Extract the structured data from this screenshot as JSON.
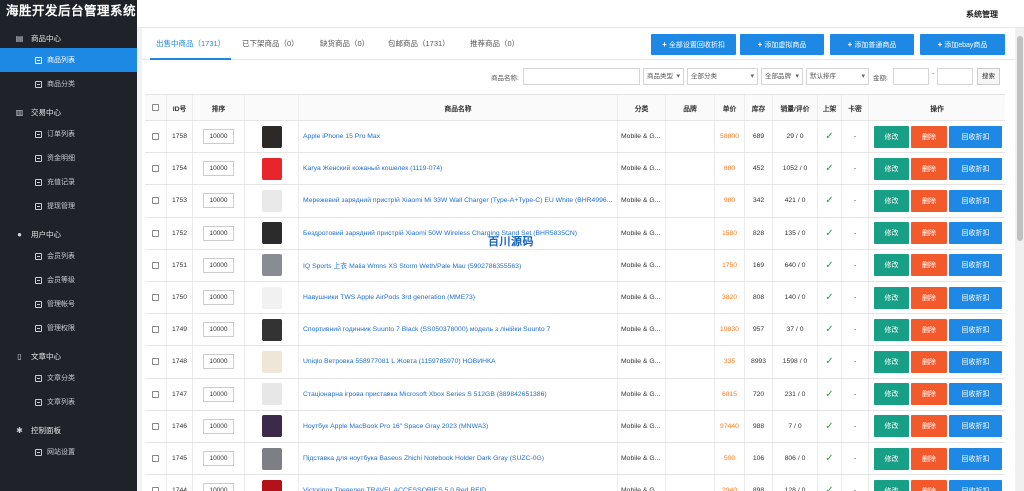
{
  "app": {
    "title": "海胜开发后台管理系统",
    "header_right": "系统管理"
  },
  "sidebar": {
    "groups": [
      {
        "label": "商品中心",
        "icon": "clipboard-icon",
        "items": [
          {
            "label": "商品列表",
            "active": true
          },
          {
            "label": "商品分类",
            "active": false
          }
        ]
      },
      {
        "label": "交易中心",
        "icon": "chart-bar-icon",
        "items": [
          {
            "label": "订单列表"
          },
          {
            "label": "资金明细"
          },
          {
            "label": "充值记录"
          },
          {
            "label": "提现管理"
          }
        ]
      },
      {
        "label": "用户中心",
        "icon": "user-icon",
        "items": [
          {
            "label": "会员列表"
          },
          {
            "label": "会员等级"
          },
          {
            "label": "管理帐号"
          },
          {
            "label": "管理权限"
          }
        ]
      },
      {
        "label": "文章中心",
        "icon": "document-icon",
        "items": [
          {
            "label": "文章分类"
          },
          {
            "label": "文章列表"
          }
        ]
      },
      {
        "label": "控制面板",
        "icon": "gear-icon",
        "items": [
          {
            "label": "网站设置"
          }
        ]
      }
    ]
  },
  "tabs": [
    {
      "label": "出售中商品（1731）",
      "active": true
    },
    {
      "label": "已下架商品（0）",
      "active": false
    },
    {
      "label": "缺货商品（0）",
      "active": false
    },
    {
      "label": "包邮商品（1731）",
      "active": false
    },
    {
      "label": "推荐商品（0）",
      "active": false
    }
  ],
  "toolbar": {
    "btn_discount": "全部设置回收折扣",
    "btn_virtual": "添加虚拟商品",
    "btn_normal": "添加普通商品",
    "btn_ebay": "添加ebay商品"
  },
  "search": {
    "name_label": "商品名称:",
    "type_select": "商品类型",
    "category_select": "全部分类",
    "brand_select": "全部品牌",
    "sort_select": "默认排序",
    "amount_label": "金额:",
    "dash": "-",
    "search_btn": "搜索"
  },
  "table": {
    "headers": {
      "id": "ID号",
      "sort": "排序",
      "name": "商品名称",
      "category": "分类",
      "brand": "品牌",
      "price": "单价",
      "stock": "库存",
      "sales": "销量/评价",
      "onshelf": "上架",
      "card": "卡密",
      "actions": "操作"
    },
    "actions": {
      "edit": "修改",
      "delete": "删除",
      "recycle": "回收折扣"
    },
    "rows": [
      {
        "id": "1758",
        "sort": "10000",
        "name": "Apple iPhone 15 Pro Max",
        "category": "Mobile & G...",
        "price": "58800",
        "stock": "689",
        "sales": "29 / 0",
        "card": "-",
        "img": "#2c2a29"
      },
      {
        "id": "1754",
        "sort": "10000",
        "name": "Karya Женский кожаный кошелек (1119-074)",
        "category": "Mobile & G...",
        "price": "680",
        "stock": "452",
        "sales": "1052 / 0",
        "card": "-",
        "img": "#e8252b"
      },
      {
        "id": "1753",
        "sort": "10000",
        "name": "Мережевий зарядний пристрій Xiaomi Mi 33W Wall Charger (Type-A+Type-C) EU White (BHR4996...",
        "category": "Mobile & G...",
        "price": "980",
        "stock": "342",
        "sales": "421 / 0",
        "card": "-",
        "img": "#e9e9e9"
      },
      {
        "id": "1752",
        "sort": "10000",
        "name": "Бездротовий зарядний пристрій Xiaomi 50W Wireless Charging Stand Set (BHR5835CN)",
        "category": "Mobile & G...",
        "price": "1580",
        "stock": "828",
        "sales": "135 / 0",
        "card": "-",
        "img": "#2b2b2b"
      },
      {
        "id": "1751",
        "sort": "10000",
        "name": "IQ Sports 上衣 Malia Wmns XS Storm Weth/Pale Mau (5902786355563)",
        "category": "Mobile & G...",
        "price": "1750",
        "stock": "169",
        "sales": "640 / 0",
        "card": "-",
        "img": "#8a8c94"
      },
      {
        "id": "1750",
        "sort": "10000",
        "name": "Навушники TWS Apple AirPods 3rd generation (MME73)",
        "category": "Mobile & G...",
        "price": "3820",
        "stock": "808",
        "sales": "140 / 0",
        "card": "-",
        "img": "#f1f1f1"
      },
      {
        "id": "1749",
        "sort": "10000",
        "name": "Спортивний годинник Suunto 7 Black (SS050378000) модель з лінійки Suunto 7",
        "category": "Mobile & G...",
        "price": "19830",
        "stock": "957",
        "sales": "37 / 0",
        "card": "-",
        "img": "#333333"
      },
      {
        "id": "1748",
        "sort": "10000",
        "name": "Uniqlo Ветровка 558977081 L Жовта (1159785970) НОВИНКА",
        "category": "Mobile & G...",
        "price": "335",
        "stock": "8993",
        "sales": "1598 / 0",
        "card": "-",
        "img": "#efe6d8"
      },
      {
        "id": "1747",
        "sort": "10000",
        "name": "Стаціонарна ігрова приставка Microsoft Xbox Series S 512GB (889842651386)",
        "category": "Mobile & G...",
        "price": "6815",
        "stock": "720",
        "sales": "231 / 0",
        "card": "-",
        "img": "#e7e7e7"
      },
      {
        "id": "1746",
        "sort": "10000",
        "name": "Ноутбук Apple MacBook Pro 16\" Space Gray 2023 (MNWA3)",
        "category": "Mobile & G...",
        "price": "97440",
        "stock": "988",
        "sales": "7 / 0",
        "card": "-",
        "img": "#3c2a4a"
      },
      {
        "id": "1745",
        "sort": "10000",
        "name": "Підставка для ноутбука Baseus Zhichi Notebook Holder Dark Gray (SUZC-0G)",
        "category": "Mobile & G...",
        "price": "500",
        "stock": "106",
        "sales": "806 / 0",
        "card": "-",
        "img": "#7d7f84"
      },
      {
        "id": "1744",
        "sort": "10000",
        "name": "Victorinox Тревелер TRAVEL ACCESSORIES 5.0 Red RFID",
        "category": "Mobile & G...",
        "price": "2940",
        "stock": "898",
        "sales": "128 / 0",
        "card": "-",
        "img": "#b3121a"
      }
    ]
  },
  "watermark": "百川源码"
}
